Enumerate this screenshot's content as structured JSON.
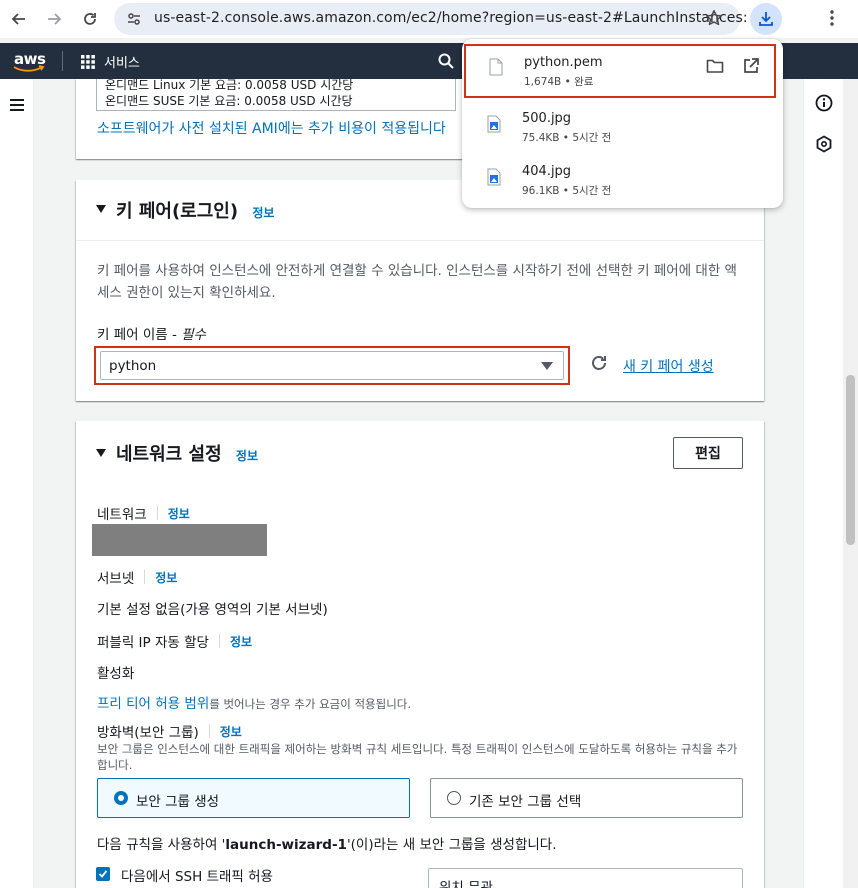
{
  "browser": {
    "url": "us-east-2.console.aws.amazon.com/ec2/home?region=us-east-2#LaunchInstances:"
  },
  "aws_nav": {
    "logo": "aws",
    "services_label": "서비스"
  },
  "top_panel": {
    "price_line1": "온디맨드 Linux 기본 요금: 0.0058 USD 시간당",
    "price_line2": "온디맨드 SUSE 기본 요금: 0.0058 USD 시간당",
    "ami_link": "소프트웨어가 사전 설치된 AMI에는 추가 비용이 적용됩니다"
  },
  "key_pair": {
    "title": "키 페어(로그인)",
    "info": "정보",
    "description": "키 페어를 사용하여 인스턴스에 안전하게 연결할 수 있습니다. 인스턴스를 시작하기 전에 선택한 키 페어에 대한 액세스 권한이 있는지 확인하세요.",
    "label": "키 페어 이름 - ",
    "label_required": "필수",
    "selected": "python",
    "new_link": "새 키 페어 생성"
  },
  "network": {
    "title": "네트워크 설정",
    "info": "정보",
    "edit": "편집",
    "network_label": "네트워크",
    "subnet_label": "서브넷",
    "subnet_value": "기본 설정 없음(가용 영역의 기본 서브넷)",
    "public_ip_label": "퍼블릭 IP 자동 할당",
    "public_ip_value": "활성화",
    "free_tier_link": "프리 티어 허용 범위",
    "free_tier_rest": "를 벗어나는 경우 추가 요금이 적용됩니다.",
    "firewall_label": "방화벽(보안 그룹)",
    "firewall_desc": "보안 그룹은 인스턴스에 대한 트래픽을 제어하는 방화벽 규칙 세트입니다. 특정 트래픽이 인스턴스에 도달하도록 허용하는 규칙을 추가합니다.",
    "option_create": "보안 그룹 생성",
    "option_existing": "기존 보안 그룹 선택",
    "create_note_pre": "다음 규칙을 사용하여 '",
    "create_note_name": "launch-wizard-1",
    "create_note_post": "'(이)라는 새 보안 그룹을 생성합니다.",
    "ssh_label": "다음에서 SSH 트래픽 허용",
    "ssh_source": "위치 무관"
  },
  "downloads": [
    {
      "name": "python.pem",
      "meta": "1,674B • 완료",
      "type": "file"
    },
    {
      "name": "500.jpg",
      "meta": "75.4KB • 5시간 전",
      "type": "image"
    },
    {
      "name": "404.jpg",
      "meta": "96.1KB • 5시간 전",
      "type": "image"
    }
  ],
  "colors": {
    "aws_nav": "#232f3e",
    "link": "#0073bb",
    "highlight": "#d13212"
  }
}
